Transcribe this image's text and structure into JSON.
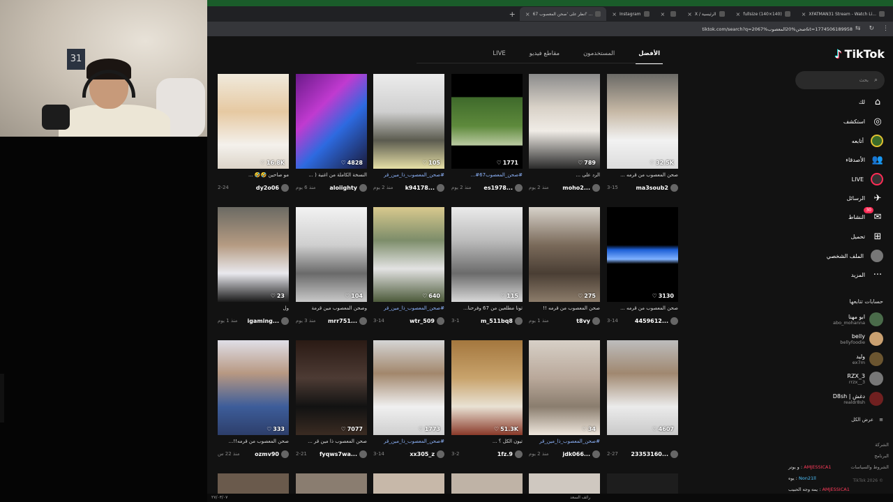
{
  "colors": {
    "accent": "#fe2c55",
    "tag": "#8fb6ff",
    "bg": "#121212"
  },
  "webcam": {
    "sign": "31"
  },
  "browser": {
    "tabs": [
      {
        "label": "XFATMAN31 Stream - Watch Li...",
        "active": false
      },
      {
        "label": "fullsize (140×140)",
        "active": false
      },
      {
        "label": "X / الرئيسية",
        "active": false
      },
      {
        "label": "",
        "active": false
      },
      {
        "label": "Instagram",
        "active": false
      },
      {
        "label": "انظر على 'صحن المعصوب 67' ...",
        "active": true
      }
    ],
    "new_tab": "+",
    "url": "tiktok.com/search?q=صحن%20المعصوب%2067&t=1774506189958"
  },
  "tiktok": {
    "logo": "TikTok",
    "search_placeholder": "بحث",
    "nav": [
      {
        "label": "لك",
        "icon": "home-icon",
        "glyph": "⌂"
      },
      {
        "label": "استكشف",
        "icon": "compass-icon",
        "glyph": "◎"
      },
      {
        "label": "أتابعه",
        "icon": "following-avatar-icon",
        "glyph": ""
      },
      {
        "label": "الأصدقاء",
        "icon": "friends-icon",
        "glyph": "👥"
      },
      {
        "label": "LIVE",
        "icon": "live-icon",
        "glyph": ""
      },
      {
        "label": "الرسائل",
        "icon": "messages-icon",
        "glyph": "✈"
      },
      {
        "label": "النشاط",
        "icon": "activity-icon",
        "glyph": "✉",
        "badge": "30"
      },
      {
        "label": "تحميل",
        "icon": "upload-icon",
        "glyph": "⊞"
      },
      {
        "label": "الملف الشخصي",
        "icon": "profile-icon",
        "glyph": ""
      },
      {
        "label": "المزيد",
        "icon": "more-icon",
        "glyph": "···"
      }
    ],
    "following_title": "حسابات تتابعها",
    "following": [
      {
        "name": "ابو مهنا",
        "handle": "abo_mohanna"
      },
      {
        "name": "belly",
        "handle": "bellyfoodie"
      },
      {
        "name": "وليد",
        "handle": "ex7m"
      },
      {
        "name": "RZX_3",
        "handle": "rrzx__3"
      },
      {
        "name": "D8sh | دغش",
        "handle": "realdr8sh"
      }
    ],
    "see_all": "عرض الكل",
    "tabs": [
      "الأفضل",
      "المستخدمون",
      "مقاطع فيديو",
      "LIVE"
    ],
    "chat": [
      {
        "user": "AMJESSICA1",
        "text": "و يوتر :"
      },
      {
        "user": "Non21ll",
        "text": "يوه :"
      },
      {
        "user": "AMJESSICA1",
        "text": "يمه وجه الحبيب :"
      }
    ],
    "footer_lines": [
      "الشركة",
      "البرنامج",
      "الشروط والسياسات"
    ],
    "copyright": "TikTok 2026 ©",
    "videos": [
      {
        "views": "32.5K",
        "desc": "صحن المعصوب من قرمه ...",
        "user": "ma3soub2",
        "date": "3-15",
        "tag": false,
        "art": "a"
      },
      {
        "views": "789",
        "desc": "الرد على ...",
        "user": "moho2...",
        "date": "منذ 2 يوم",
        "tag": false,
        "art": "b"
      },
      {
        "views": "1771",
        "desc": "#صحن_المعصوب67#...",
        "user": "es1978...",
        "date": "منذ 2 يوم",
        "tag": true,
        "art": "c"
      },
      {
        "views": "105",
        "desc": "#صحن_المعصوب_ذا_مين_قر",
        "user": "k94178...",
        "date": "منذ 2 يوم",
        "tag": true,
        "art": "d"
      },
      {
        "views": "4828",
        "desc": "النسخة الكاملة من اغنية ( ...",
        "user": "aloiighty",
        "date": "منذ 6 يوم",
        "tag": false,
        "art": "e"
      },
      {
        "views": "16.8K",
        "desc": "مو صاحين 🤣🤣 ...",
        "user": "dy2o06",
        "date": "2-24",
        "tag": false,
        "art": "f"
      },
      {
        "views": "3130",
        "desc": "صحن المعصوب من قرمه ...",
        "user": "4459612...",
        "date": "3-14",
        "tag": false,
        "art": "g"
      },
      {
        "views": "275",
        "desc": "صحن المعصوب من قرمه !!",
        "user": "t8vy",
        "date": "منذ 1 يوم",
        "tag": false,
        "art": "h"
      },
      {
        "views": "115",
        "desc": "تونا مطلعين من 67 وفرحنا...",
        "user": "m_511bq8",
        "date": "3-1",
        "tag": false,
        "art": "i"
      },
      {
        "views": "640",
        "desc": "#صحن_المعصوب_ذا_مين_قر",
        "user": "wtr_509",
        "date": "3-14",
        "tag": true,
        "art": "j"
      },
      {
        "views": "104",
        "desc": "وصحن المعصوب مين قرمة",
        "user": "mrr751...",
        "date": "منذ 3 يوم",
        "tag": false,
        "art": "k"
      },
      {
        "views": "23",
        "desc": "ول",
        "user": "igaming...",
        "date": "منذ 1 يوم",
        "tag": false,
        "art": "l"
      },
      {
        "views": "4607",
        "desc": "",
        "user": "23353160...",
        "date": "2-27",
        "tag": false,
        "art": "m"
      },
      {
        "views": "34",
        "desc": "#صحن_المعصوب_ذا_مين_قر",
        "user": "jdk066...",
        "date": "منذ 2 يوم",
        "tag": true,
        "art": "n"
      },
      {
        "views": "51.3K",
        "desc": "تيون الكل ؟ ...",
        "user": "1fz.9",
        "date": "3-2",
        "tag": false,
        "art": "o"
      },
      {
        "views": "1773",
        "desc": "#صحن_المعصوب_ذا_مين_قر",
        "user": "xx305_z",
        "date": "3-14",
        "tag": true,
        "art": "p"
      },
      {
        "views": "7077",
        "desc": "صحن المعصوب ذا مين قر ...",
        "user": "fyqws7wa...",
        "date": "2-21",
        "tag": false,
        "art": "q"
      },
      {
        "views": "333",
        "desc": "صحن المعصوب من قرمه!!...",
        "user": "ozmv90",
        "date": "منذ 22 س",
        "tag": false,
        "art": "r"
      }
    ]
  },
  "taskbar": {
    "left": "٢٧/٠٣/٠٧",
    "right": "رائف السعد"
  }
}
